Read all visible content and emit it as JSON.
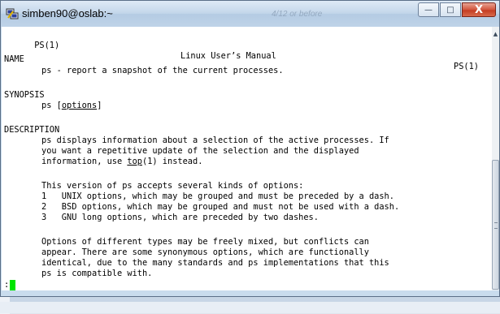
{
  "window": {
    "title": "simben90@oslab:~",
    "background_tab_text": "4/12 or before",
    "buttons": {
      "minimize": "—",
      "maximize": "□",
      "close": "X"
    }
  },
  "terminal": {
    "header_left": "PS(1)",
    "header_center": "Linux User’s Manual",
    "header_right": "PS(1)",
    "name_heading": "NAME",
    "name_text": "ps - report a snapshot of the current processes.",
    "synopsis_heading": "SYNOPSIS",
    "synopsis_cmd": "ps [",
    "synopsis_options": "options",
    "synopsis_end": "]",
    "description_heading": "DESCRIPTION",
    "desc_line1": "ps displays information about a selection of the active processes. If",
    "desc_line2": "you want a repetitive update of the selection and the displayed",
    "desc_line3_a": "information, use ",
    "desc_line3_link": "top",
    "desc_line3_b": "(1) instead.",
    "versions_intro": "This version of ps accepts several kinds of options:",
    "option1": "1   UNIX options, which may be grouped and must be preceded by a dash.",
    "option2": "2   BSD options, which may be grouped and must not be used with a dash.",
    "option3": "3   GNU long options, which are preceded by two dashes.",
    "mix_line1": "Options of different types may be freely mixed, but conflicts can",
    "mix_line2": "appear. There are some synonymous options, which are functionally",
    "mix_line3": "identical, due to the many standards and ps implementations that this",
    "mix_line4": "ps is compatible with.",
    "prompt": ":"
  },
  "colors": {
    "cursor": "#00e600",
    "terminal_bg": "#ffffff",
    "titlebar": "#c3d6ea",
    "close_button": "#c33d22"
  },
  "icons": {
    "window_icon": "putty-icon",
    "minimize": "minimize-icon",
    "maximize": "maximize-icon",
    "close": "close-icon",
    "scroll_up": "scroll-up-arrow-icon"
  }
}
